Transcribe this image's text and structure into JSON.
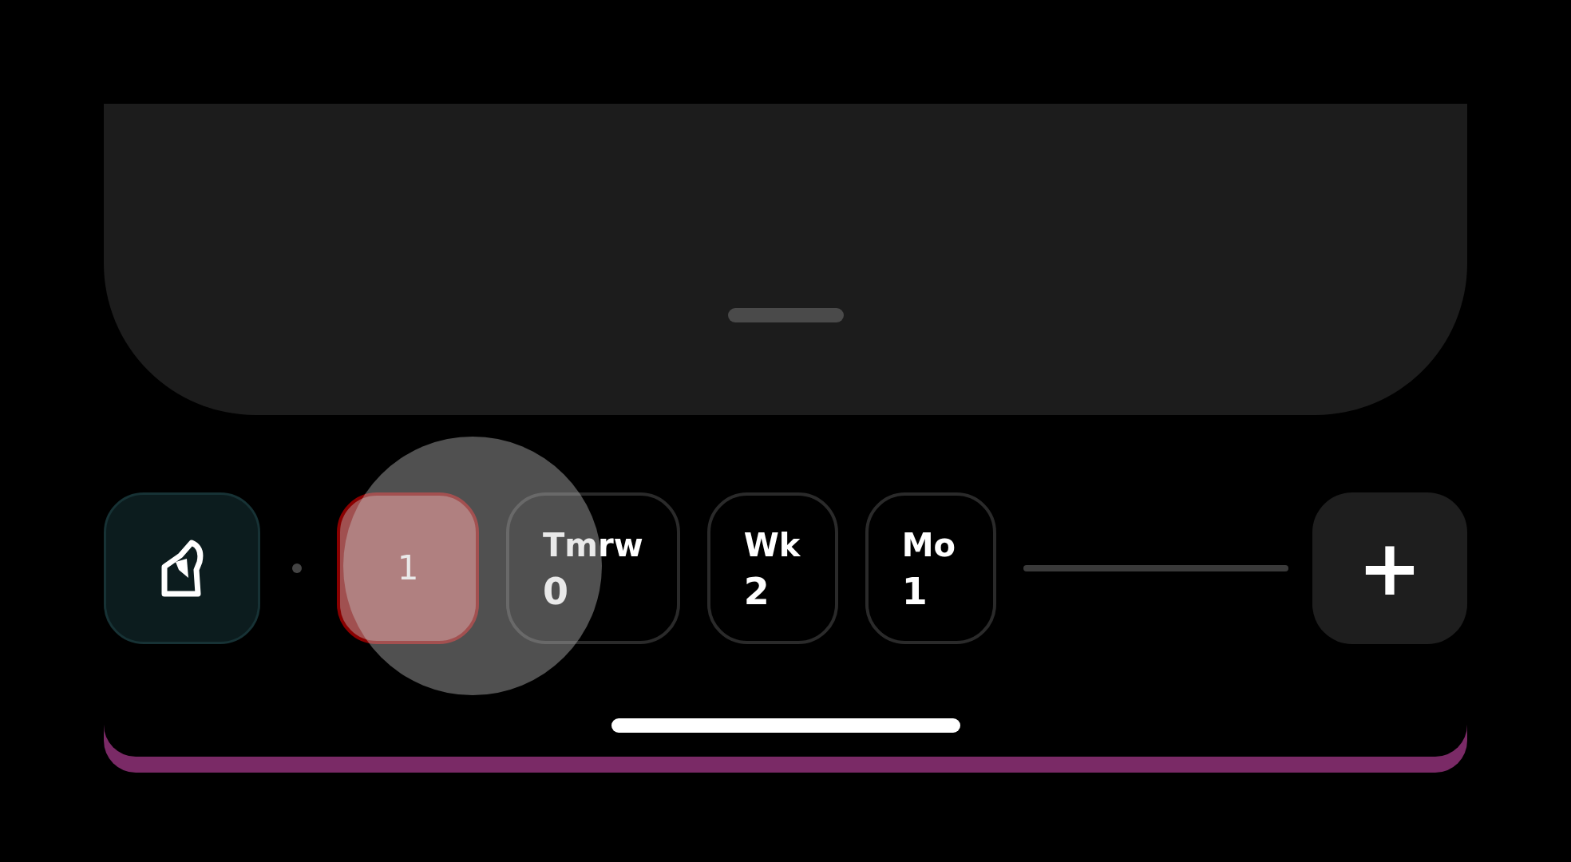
{
  "filter_chips": [
    {
      "count": "1",
      "selected": true
    },
    {
      "label": "Tmrw",
      "count": "0",
      "selected": false
    },
    {
      "label": "Wk",
      "count": "2",
      "selected": false
    },
    {
      "label": "Mo",
      "count": "1",
      "selected": false
    }
  ],
  "add_button": {
    "label": "+"
  }
}
